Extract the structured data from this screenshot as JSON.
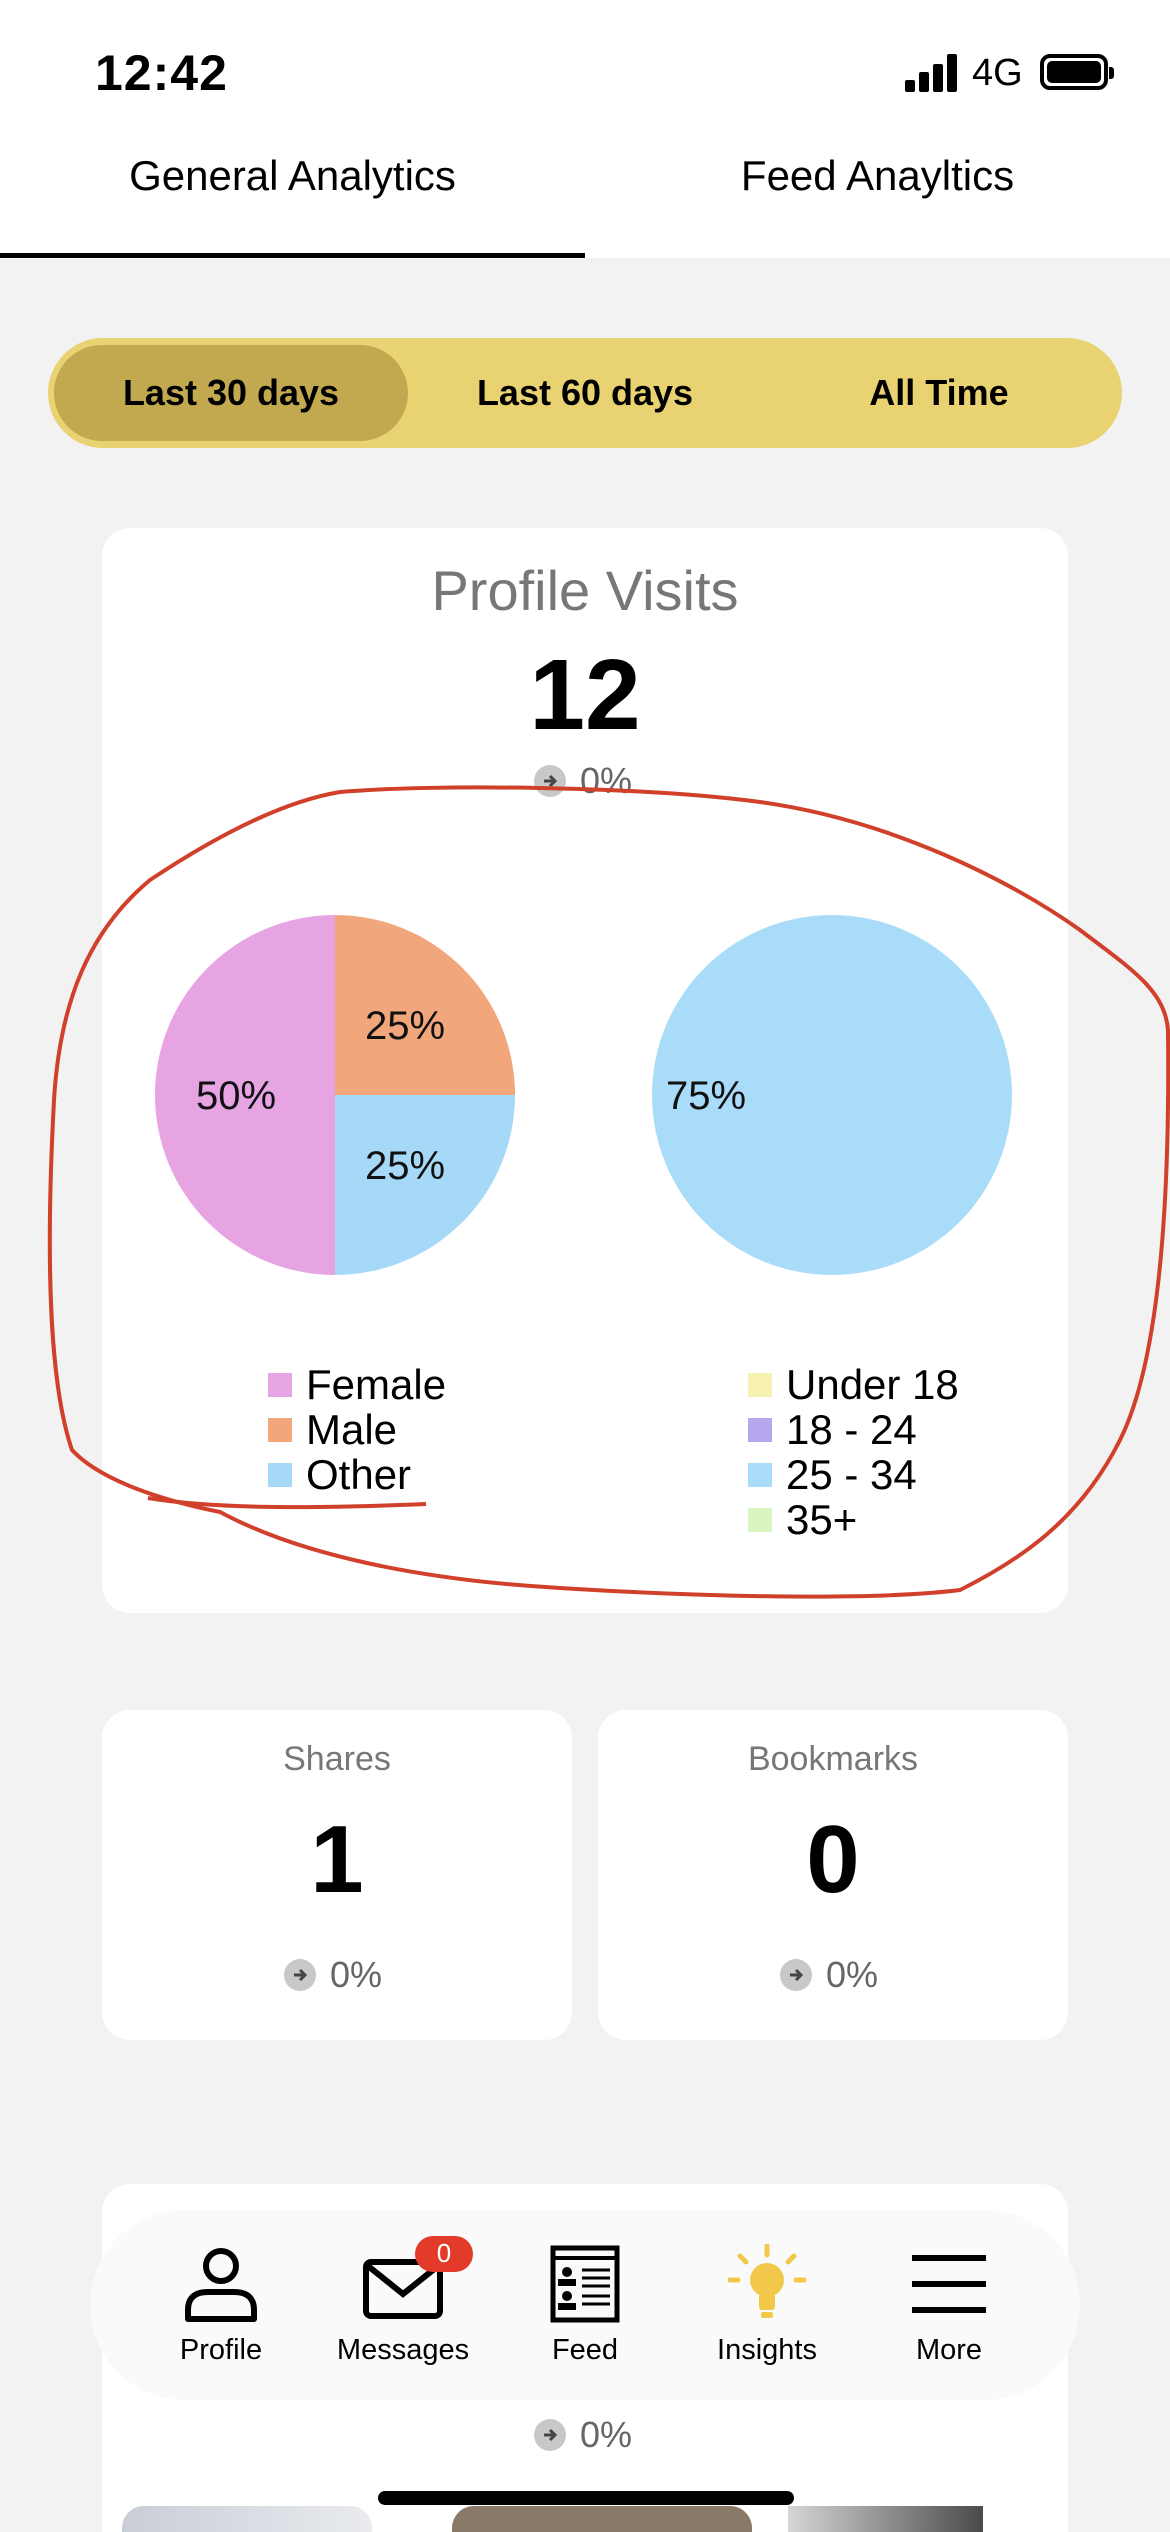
{
  "status_bar": {
    "time": "12:42",
    "network": "4G"
  },
  "tabs": [
    {
      "label": "General Analytics",
      "active": true
    },
    {
      "label": "Feed Anayltics",
      "active": false
    }
  ],
  "range_selector": {
    "options": [
      "Last 30 days",
      "Last 60 days",
      "All Time"
    ],
    "selected": "Last 30 days"
  },
  "profile_visits": {
    "title": "Profile Visits",
    "value": "12",
    "change": "0%"
  },
  "chart_data": [
    {
      "type": "pie",
      "title": "",
      "labels": [
        "Female",
        "Male",
        "Other"
      ],
      "values": [
        50,
        25,
        25
      ],
      "value_labels": [
        "50%",
        "25%",
        "25%"
      ],
      "colors": [
        "#e6a4e2",
        "#f2a67b",
        "#a6d8f8"
      ],
      "legend": {
        "position": "bottom",
        "entries": [
          "Female",
          "Male",
          "Other"
        ]
      }
    },
    {
      "type": "pie",
      "title": "",
      "labels": [
        "Under 18",
        "18 - 24",
        "25 - 34",
        "35+"
      ],
      "values": [
        0,
        0,
        75,
        0
      ],
      "value_labels": [
        "",
        "",
        "75%",
        ""
      ],
      "colors": [
        "#f7f2b2",
        "#b7a7ee",
        "#a9dcf8",
        "#d9f5c0"
      ],
      "legend": {
        "position": "bottom",
        "entries": [
          "Under 18",
          "18 - 24",
          "25 - 34",
          "35+"
        ]
      }
    }
  ],
  "shares": {
    "title": "Shares",
    "value": "1",
    "change": "0%"
  },
  "bookmarks": {
    "title": "Bookmarks",
    "value": "0",
    "change": "0%"
  },
  "bottom_card": {
    "change": "0%"
  },
  "bottom_nav": {
    "items": [
      {
        "label": "Profile",
        "icon": "person-icon"
      },
      {
        "label": "Messages",
        "icon": "envelope-icon",
        "badge": "0"
      },
      {
        "label": "Feed",
        "icon": "feed-icon"
      },
      {
        "label": "Insights",
        "icon": "lightbulb-icon"
      },
      {
        "label": "More",
        "icon": "menu-icon"
      }
    ]
  },
  "colors": {
    "segment_bg": "#e8d272",
    "segment_active": "#c2a84f",
    "badge": "#e23b2a",
    "insights_accent": "#f2c84b",
    "annotation": "#d0402a"
  }
}
